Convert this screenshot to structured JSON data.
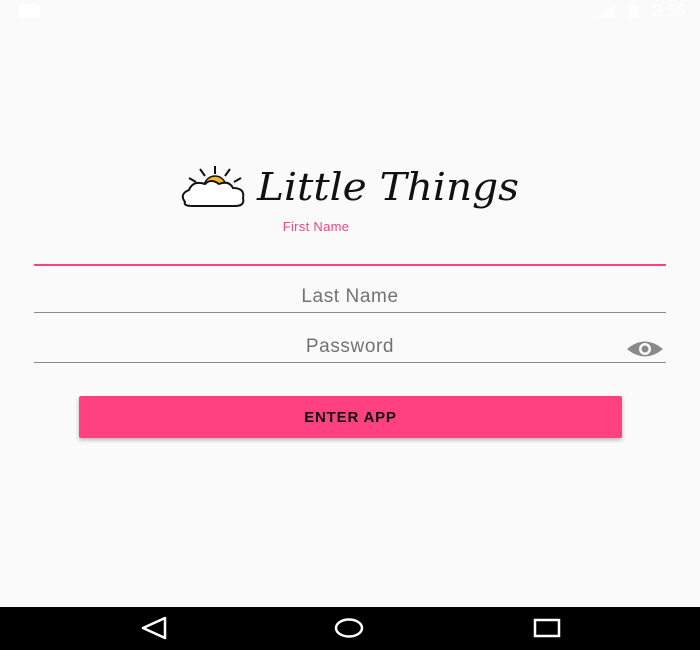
{
  "status_bar": {
    "time": "3:56",
    "left_icon": "notification-icon",
    "right_icons": [
      "signal-off-icon",
      "battery-icon"
    ]
  },
  "logo": {
    "text": "Little Things",
    "icon": "sun-cloud-icon"
  },
  "form": {
    "first_name": {
      "label": "First Name",
      "value": ""
    },
    "last_name": {
      "placeholder": "Last Name"
    },
    "password": {
      "placeholder": "Password",
      "toggle_icon": "eye-icon"
    },
    "submit_label": "ENTER APP"
  },
  "nav_bar": {
    "buttons": [
      "back-icon",
      "home-icon",
      "recents-icon"
    ]
  },
  "colors": {
    "accent": "#ff4081",
    "background": "#fafafa",
    "divider": "#8a8a8a",
    "nav_bar": "#000000"
  }
}
